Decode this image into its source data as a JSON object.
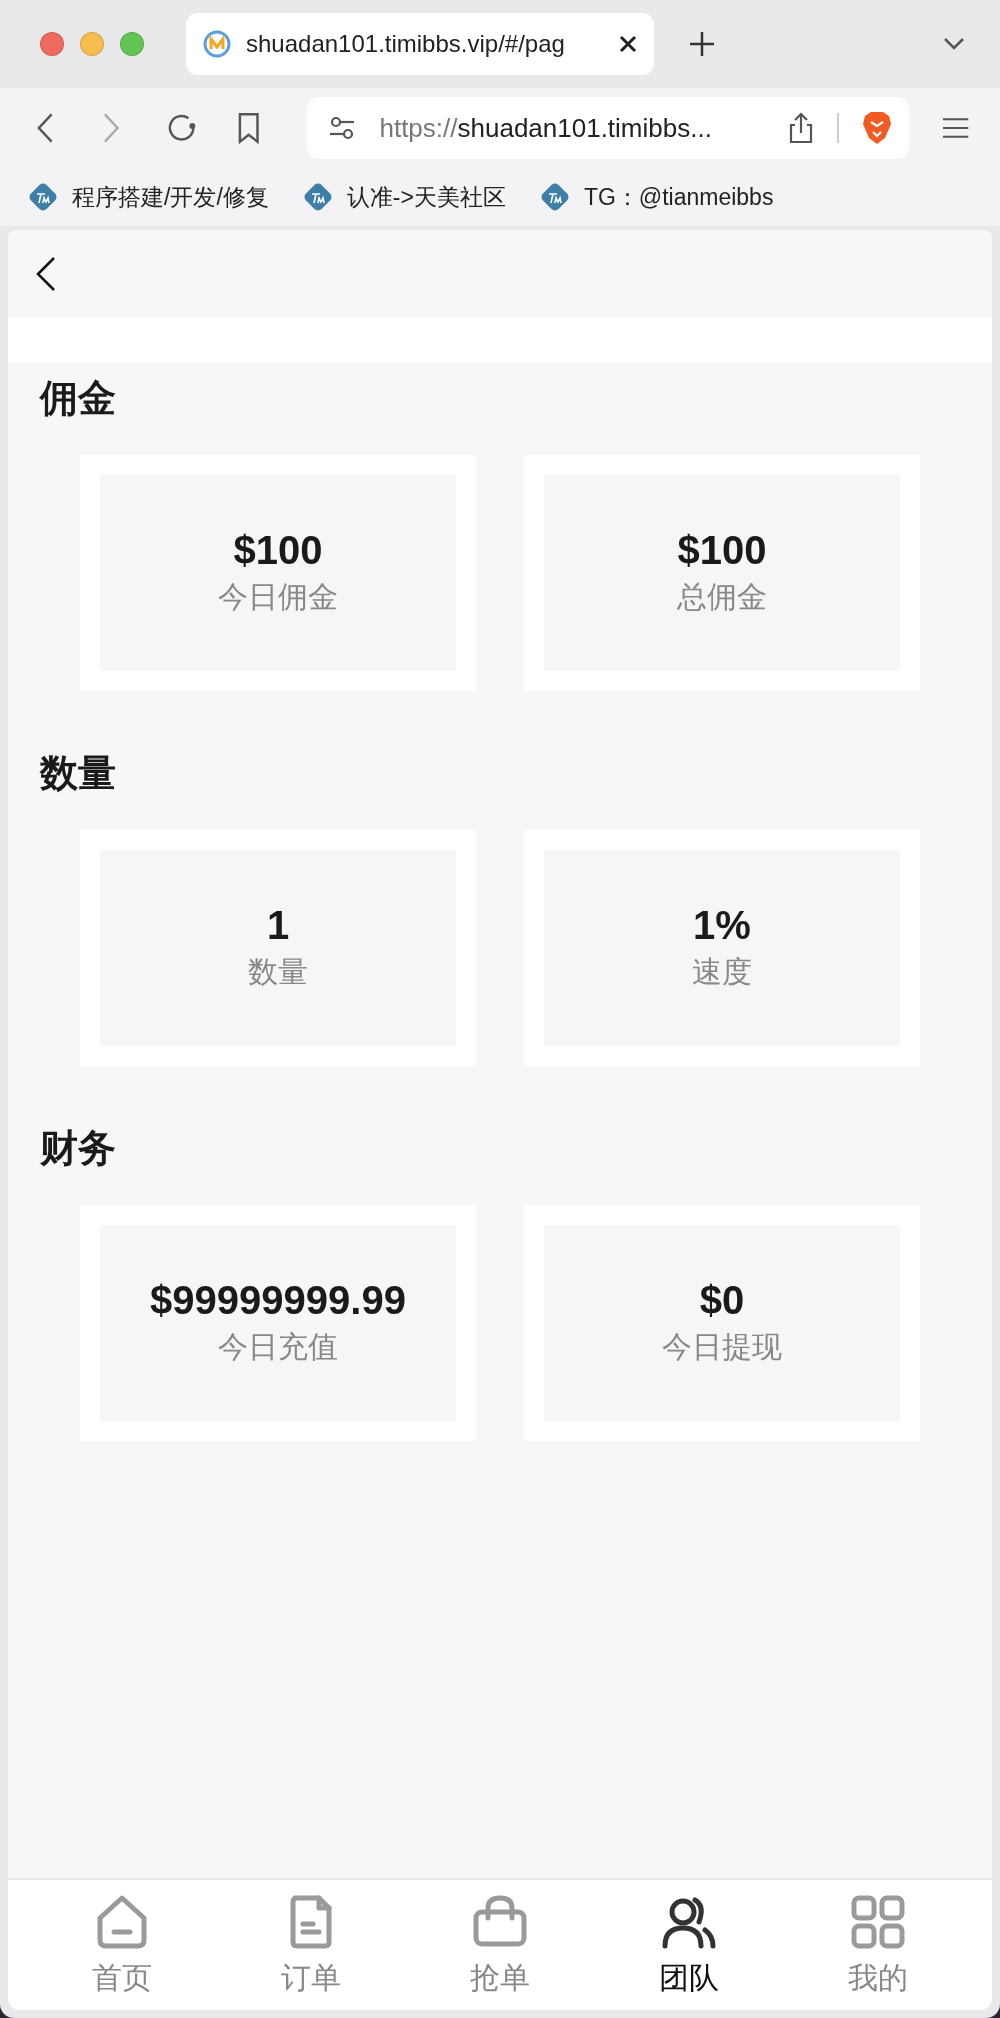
{
  "browser": {
    "tab_title": "shuadan101.timibbs.vip/#/pag",
    "url_scheme": "https://",
    "url_rest": "shuadan101.timibbs...",
    "bookmarks": [
      "程序搭建/开发/修复",
      "认准->天美社区",
      "TG：@tianmeibbs"
    ]
  },
  "sections": [
    {
      "title": "佣金",
      "stats": [
        {
          "value": "$100",
          "label": "今日佣金"
        },
        {
          "value": "$100",
          "label": "总佣金"
        }
      ]
    },
    {
      "title": "数量",
      "stats": [
        {
          "value": "1",
          "label": "数量"
        },
        {
          "value": "1%",
          "label": "速度"
        }
      ]
    },
    {
      "title": "财务",
      "stats": [
        {
          "value": "$99999999.99",
          "label": "今日充值"
        },
        {
          "value": "$0",
          "label": "今日提现"
        }
      ]
    }
  ],
  "nav": [
    {
      "kind": "home",
      "label": "首页",
      "selected": false
    },
    {
      "kind": "orders",
      "label": "订单",
      "selected": false
    },
    {
      "kind": "grab",
      "label": "抢单",
      "selected": false
    },
    {
      "kind": "team",
      "label": "团队",
      "selected": true
    },
    {
      "kind": "mine",
      "label": "我的",
      "selected": false
    }
  ]
}
